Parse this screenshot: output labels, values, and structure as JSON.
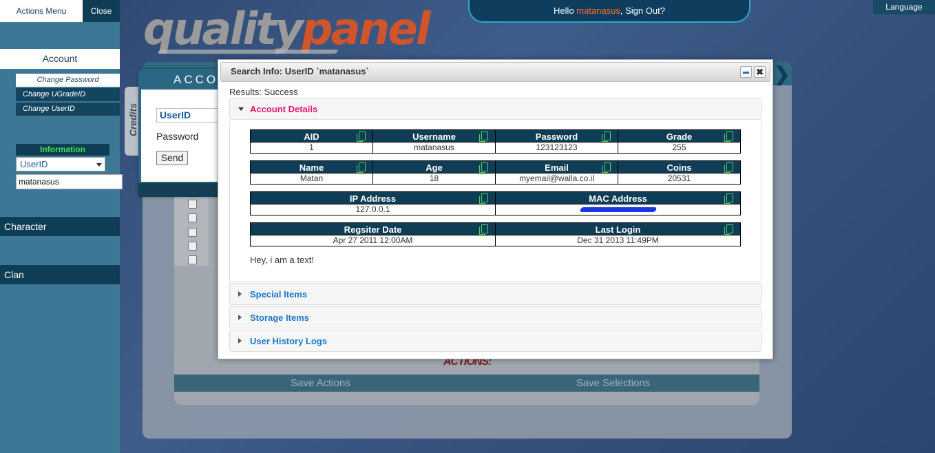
{
  "header": {
    "logo_left": "quality",
    "logo_right": "panel",
    "greeting": "Hello",
    "username": "matanasus",
    "signout": ", Sign Out?",
    "language": "Language"
  },
  "sidebar": {
    "actions_menu": "Actions Menu",
    "close": "Close",
    "account": "Account",
    "sub_items": [
      "Change Password",
      "Change UGradeID",
      "Change UserID"
    ],
    "information": "Information",
    "search_type": "UserID",
    "search_value": "matanasus",
    "categories": [
      "Character",
      "Clan"
    ]
  },
  "background_panel": {
    "account_title": "ACCOUNT",
    "credits_tab": "Credits",
    "selector": "UserID",
    "password_label": "Password",
    "send": "Send",
    "actions_label": "ACTIONS:",
    "save_actions": "Save Actions",
    "save_selections": "Save Selections"
  },
  "dialog": {
    "title": "Search Info: UserID `matanasus`",
    "minimize_icon": "minimize-icon",
    "close_icon": "close-icon",
    "results": "Results: Success",
    "sections": [
      {
        "title": "Account Details",
        "expanded": true
      },
      {
        "title": "Special Items",
        "expanded": false
      },
      {
        "title": "Storage Items",
        "expanded": false
      },
      {
        "title": "User History Logs",
        "expanded": false
      }
    ],
    "groups": [
      {
        "headers": [
          "AID",
          "Username",
          "Password",
          "Grade"
        ],
        "values": [
          "1",
          "matanasus",
          "123123123",
          "255"
        ]
      },
      {
        "headers": [
          "Name",
          "Age",
          "Email",
          "Coins"
        ],
        "values": [
          "Matan",
          "18",
          "myemail@walla.co.il",
          "20531"
        ]
      },
      {
        "headers": [
          "IP Address",
          "MAC Address"
        ],
        "values": [
          "127.0.0.1",
          ""
        ]
      },
      {
        "headers": [
          "Regsiter Date",
          "Last Login"
        ],
        "values": [
          "Apr 27 2011 12:00AM",
          "Dec 31 2013 11:49PM"
        ]
      }
    ],
    "free_text": "Hey, i am a text!"
  },
  "colors": {
    "accent_pink": "#e3166e",
    "link_blue": "#1c78c8",
    "header_navy": "#0f3d55",
    "username_orange": "#ff6a2a",
    "information_green": "#3ce24a",
    "redaction_blue": "#1c35e0"
  }
}
